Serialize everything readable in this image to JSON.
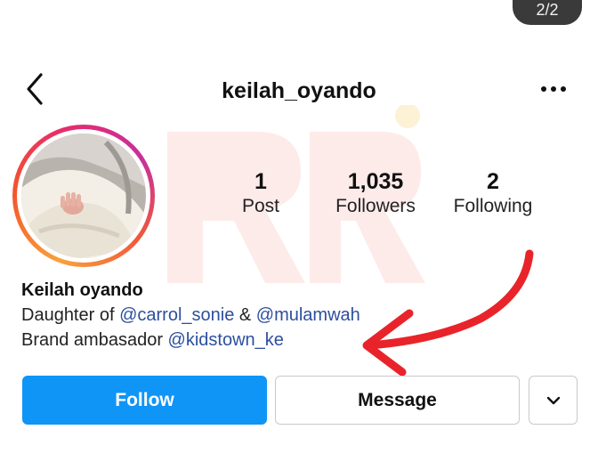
{
  "page_indicator": "2/2",
  "header": {
    "username": "keilah_oyando"
  },
  "stats": [
    {
      "value": "1",
      "label": "Post"
    },
    {
      "value": "1,035",
      "label": "Followers"
    },
    {
      "value": "2",
      "label": "Following"
    }
  ],
  "bio": {
    "name": "Keilah oyando",
    "line1_prefix": "Daughter of ",
    "mention1": "@carrol_sonie",
    "line1_joiner": " & ",
    "mention2": "@mulamwah",
    "line2_prefix": "Brand ambasador ",
    "mention3": "@kidstown_ke"
  },
  "actions": {
    "follow_label": "Follow",
    "message_label": "Message"
  },
  "colors": {
    "follow_button": "#0f95f6",
    "mention_link": "#2d4f9e",
    "annotation_arrow": "#e8242a"
  },
  "icons": [
    "back-chevron-icon",
    "more-options-icon",
    "chevron-down-icon"
  ]
}
